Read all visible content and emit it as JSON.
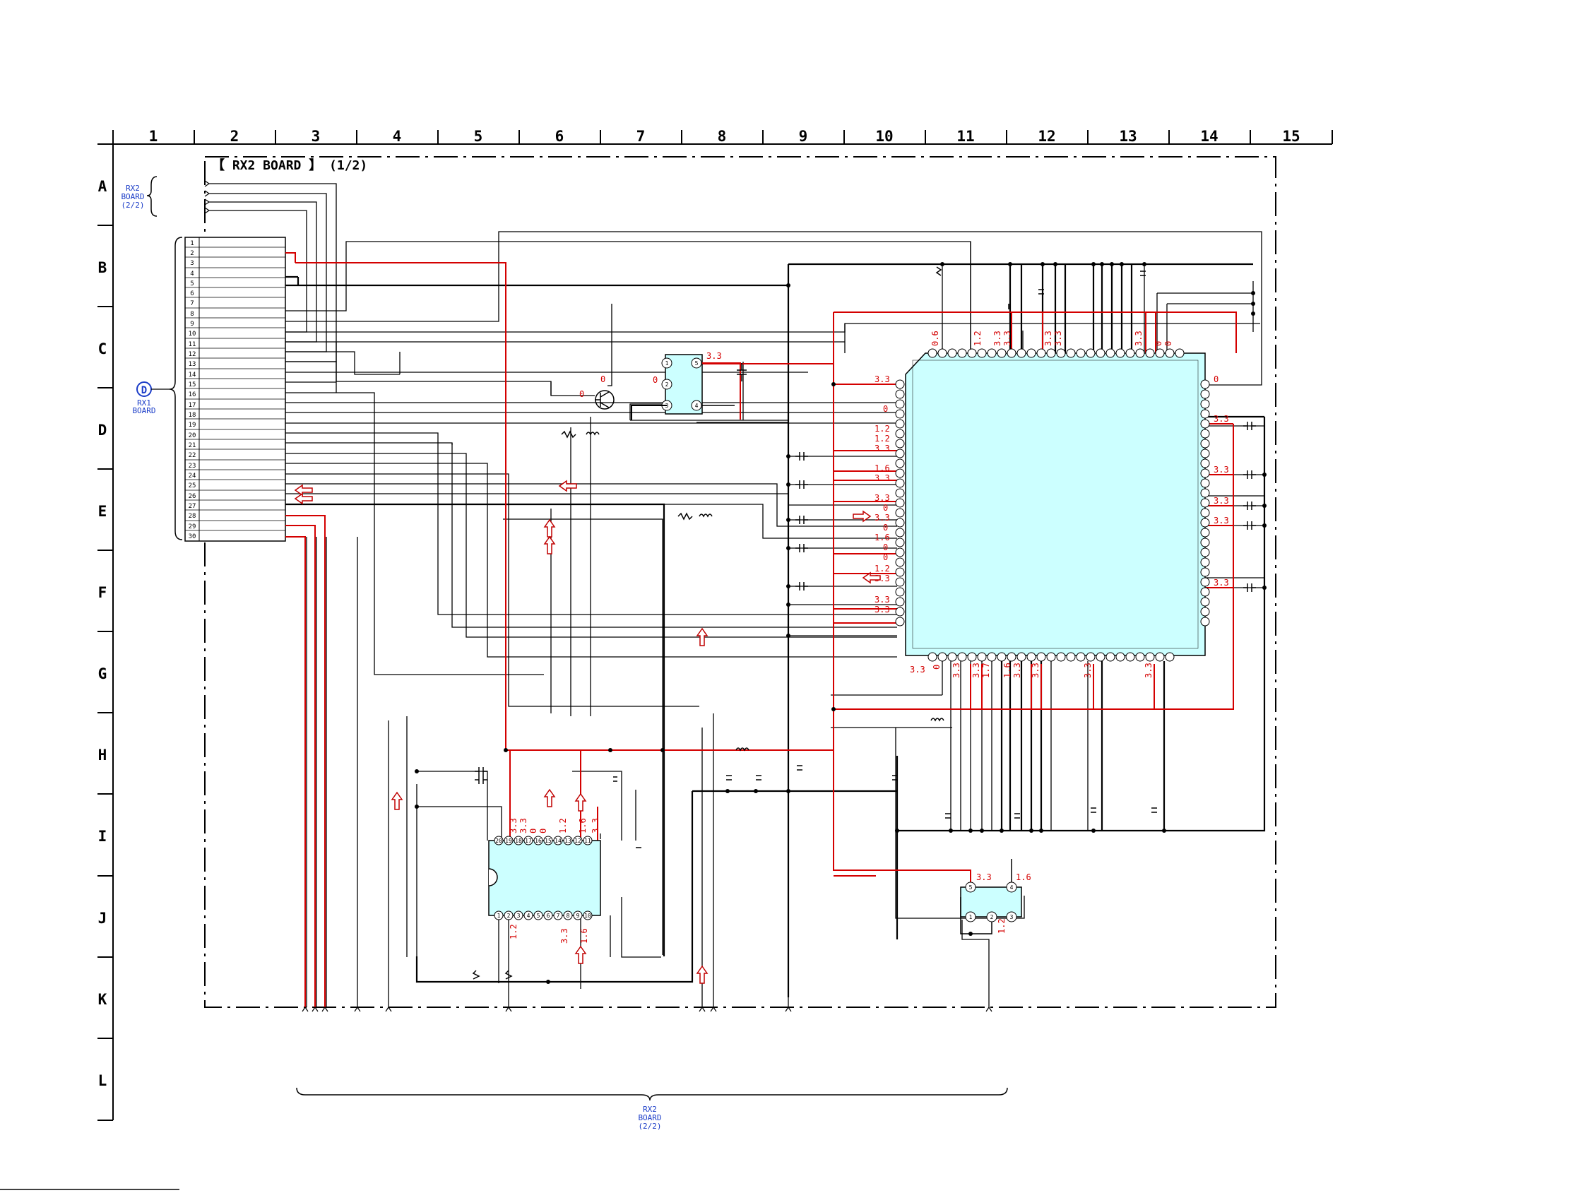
{
  "board_title": "【 RX2  BOARD 】 (1/2)",
  "columns": [
    "1",
    "2",
    "3",
    "4",
    "5",
    "6",
    "7",
    "8",
    "9",
    "10",
    "11",
    "12",
    "13",
    "14",
    "15"
  ],
  "rows": [
    "A",
    "B",
    "C",
    "D",
    "E",
    "F",
    "G",
    "H",
    "I",
    "J",
    "K",
    "L"
  ],
  "refs": {
    "rx2_top": [
      "RX2",
      "BOARD",
      "(2/2)"
    ],
    "rx1_badge": "D",
    "rx1": [
      "RX1",
      "BOARD"
    ],
    "rx2_bottom": [
      "RX2",
      "BOARD",
      "(2/2)"
    ]
  },
  "colors": {
    "wire": "#000000",
    "power_wire": "#d40000",
    "ic_fill": "#ccffff",
    "ref_blue": "#1a3cc8",
    "voltage": "#d40000"
  },
  "connector_pins": [
    "1",
    "2",
    "3",
    "4",
    "5",
    "6",
    "7",
    "8",
    "9",
    "10",
    "11",
    "12",
    "13",
    "14",
    "15",
    "16",
    "17",
    "18",
    "19",
    "20",
    "21",
    "22",
    "23",
    "24",
    "25",
    "26",
    "27",
    "28",
    "29",
    "30"
  ],
  "main_ic": {
    "top_voltages": [
      "0.6",
      "3.3",
      "1.2",
      "3.3",
      "3.3",
      "3.3",
      "3.3",
      "0",
      "0"
    ],
    "left_voltages": [
      "3.3",
      "0",
      "1.2",
      "1.2",
      "3.3",
      "1.6",
      "3.3",
      "3.3",
      "0",
      "3.3",
      "0",
      "1.6",
      "0",
      "0",
      "1.2",
      "3.3",
      "3.3",
      "3.3"
    ],
    "right_voltages": [
      "0",
      "3.3",
      "3.3",
      "3.3",
      "3.3",
      "3.3"
    ],
    "bottom_voltages": [
      "3.3",
      "0",
      "3.3",
      "3.3",
      "1.7",
      "1.6",
      "3.3",
      "3.3",
      "3.3",
      "3.3"
    ]
  },
  "small_ic": {
    "pins": [
      "1",
      "2",
      "3",
      "4",
      "5"
    ],
    "voltages": [
      "3.3",
      "0",
      "0",
      "0"
    ]
  },
  "ic20": {
    "top_pins": [
      "20",
      "19",
      "18",
      "17",
      "16",
      "15",
      "14",
      "13",
      "12",
      "11"
    ],
    "bottom_pins": [
      "1",
      "2",
      "3",
      "4",
      "5",
      "6",
      "7",
      "8",
      "9",
      "10"
    ],
    "top_voltages": [
      "3.3",
      "3.3",
      "0",
      "0",
      "1.2",
      "1.6",
      "3.3"
    ],
    "bottom_voltages": [
      "1.2",
      "3.3",
      "1.6"
    ]
  },
  "reg_ic": {
    "pins": [
      "5",
      "4",
      "1",
      "2",
      "3"
    ],
    "voltages": [
      "3.3",
      "1.6",
      "1.2"
    ]
  }
}
